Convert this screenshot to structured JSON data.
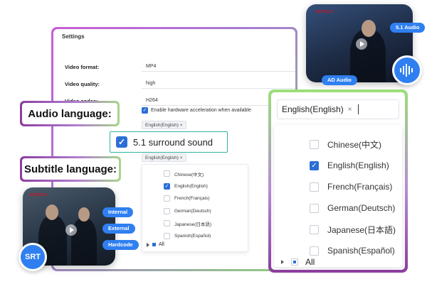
{
  "settings": {
    "title": "Settings",
    "video_format_label": "Video format:",
    "video_format_value": "MP4",
    "video_quality_label": "Video quality:",
    "video_quality_value": "high",
    "video_codec_label": "Video codec:",
    "video_codec_value": "H264",
    "hw_accel_label": "Enable hardware acceleration when available",
    "audio_tag": "English(English)  ×",
    "subtitle_tag": "English(English)  ×",
    "subtitle_options": [
      {
        "label": "Chinese(中文)",
        "checked": false
      },
      {
        "label": "English(English)",
        "checked": true
      },
      {
        "label": "French(Français)",
        "checked": false
      },
      {
        "label": "German(Deutsch)",
        "checked": false
      },
      {
        "label": "Japanese(日本語)",
        "checked": false
      },
      {
        "label": "Spanish(Español)",
        "checked": false
      }
    ],
    "all_label": "All"
  },
  "callouts": {
    "audio_language": "Audio language:",
    "subtitle_language": "Subtitle language:",
    "surround_sound": "5.1 surround sound"
  },
  "video_top": {
    "brand": "NETFLIX",
    "badge_51": "5.1 Audio",
    "badge_ad": "AD Audio",
    "icon": "audio-wave-icon"
  },
  "video_left": {
    "brand": "NETFLIX",
    "badge_internal": "Internal",
    "badge_external": "External",
    "badge_hardcode": "Hardcode",
    "badge_srt": "SRT"
  },
  "zoom": {
    "selected_tag": "English(English)",
    "tag_close": "×",
    "options": [
      {
        "label": "Chinese(中文)",
        "checked": false
      },
      {
        "label": "English(English)",
        "checked": true
      },
      {
        "label": "French(Français)",
        "checked": false
      },
      {
        "label": "German(Deutsch)",
        "checked": false
      },
      {
        "label": "Japanese(日本語)",
        "checked": false
      },
      {
        "label": "Spanish(Español)",
        "checked": false
      }
    ],
    "all_label": "All"
  },
  "colors": {
    "accent_blue": "#2f7ff0",
    "check_blue": "#2b6fd6",
    "border_teal": "#2eb3a0",
    "gradient_purple": "#8b3d9e",
    "gradient_green": "#9be07a"
  }
}
